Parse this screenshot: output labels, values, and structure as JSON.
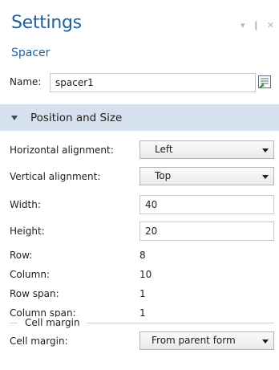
{
  "window": {
    "title": "Settings",
    "subtitle": "Spacer",
    "controls": [
      "▾",
      "❙",
      "✕"
    ]
  },
  "name_field": {
    "label": "Name:",
    "value": "spacer1",
    "button_icon": "edit-label-icon"
  },
  "section": {
    "title": "Position and Size",
    "expanded": true
  },
  "fields": {
    "horizontal_alignment": {
      "label": "Horizontal alignment:",
      "value": "Left"
    },
    "vertical_alignment": {
      "label": "Vertical alignment:",
      "value": "Top"
    },
    "width": {
      "label": "Width:",
      "value": "40"
    },
    "height": {
      "label": "Height:",
      "value": "20"
    },
    "row": {
      "label": "Row:",
      "value": "8"
    },
    "column": {
      "label": "Column:",
      "value": "10"
    },
    "row_span": {
      "label": "Row span:",
      "value": "1"
    },
    "column_span": {
      "label": "Column span:",
      "value": "1"
    }
  },
  "cell_margin_group": {
    "title": "Cell margin",
    "field": {
      "label": "Cell margin:",
      "value": "From parent form"
    }
  },
  "colors": {
    "title_blue": "#1f5fa0",
    "section_bg": "#d5e1ed"
  }
}
